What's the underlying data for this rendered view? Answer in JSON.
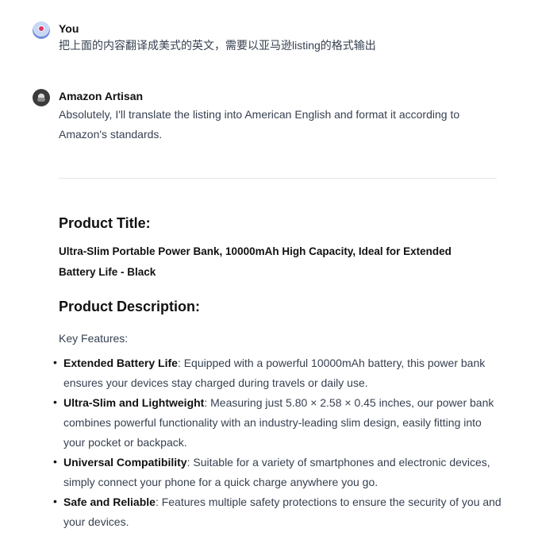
{
  "user_message": {
    "author": "You",
    "text": "把上面的内容翻译成美式的英文，需要以亚马逊listing的格式输出"
  },
  "assistant_message": {
    "author": "Amazon Artisan",
    "intro": "Absolutely, I'll translate the listing into American English and format it according to Amazon's standards.",
    "product_title_heading": "Product Title:",
    "product_title": "Ultra-Slim Portable Power Bank, 10000mAh High Capacity, Ideal for Extended Battery Life - Black",
    "product_description_heading": "Product Description:",
    "key_features_label": "Key Features:",
    "features": [
      {
        "name": "Extended Battery Life",
        "text": ": Equipped with a powerful 10000mAh battery, this power bank ensures your devices stay charged during travels or daily use."
      },
      {
        "name": "Ultra-Slim and Lightweight",
        "text": ": Measuring just 5.80 × 2.58 × 0.45 inches, our power bank combines powerful functionality with an industry-leading slim design, easily fitting into your pocket or backpack."
      },
      {
        "name": "Universal Compatibility",
        "text": ": Suitable for a variety of smartphones and electronic devices, simply connect your phone for a quick charge anywhere you go."
      },
      {
        "name": "Safe and Reliable",
        "text": ": Features multiple safety protections to ensure the security of you and your devices."
      }
    ]
  }
}
